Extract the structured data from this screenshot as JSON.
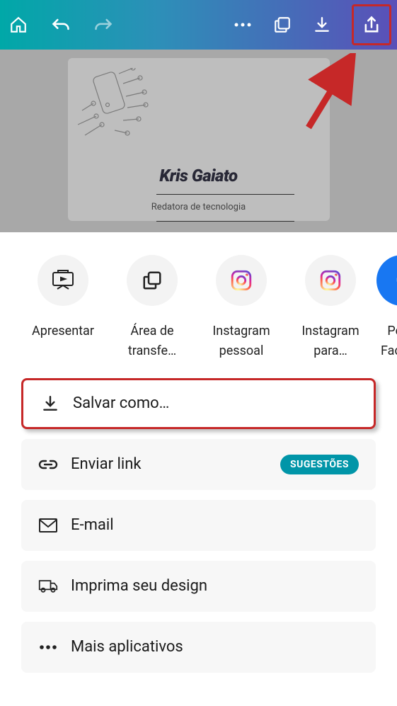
{
  "card": {
    "name": "Kris Gaiato",
    "subtitle": "Redatora de tecnologia"
  },
  "share_targets": [
    {
      "label": "Apresentar",
      "icon": "present-icon"
    },
    {
      "label": "Área de transfe…",
      "icon": "clipboard-icon"
    },
    {
      "label": "Instagram pessoal",
      "icon": "instagram-icon"
    },
    {
      "label": "Instagram para…",
      "icon": "instagram-icon"
    },
    {
      "label": "Perfil Facebook",
      "icon": "facebook-icon"
    }
  ],
  "options": {
    "save_as": "Salvar como…",
    "send_link": "Enviar link",
    "badge": "SUGESTÕES",
    "email": "E-mail",
    "print": "Imprima seu design",
    "more": "Mais aplicativos"
  }
}
